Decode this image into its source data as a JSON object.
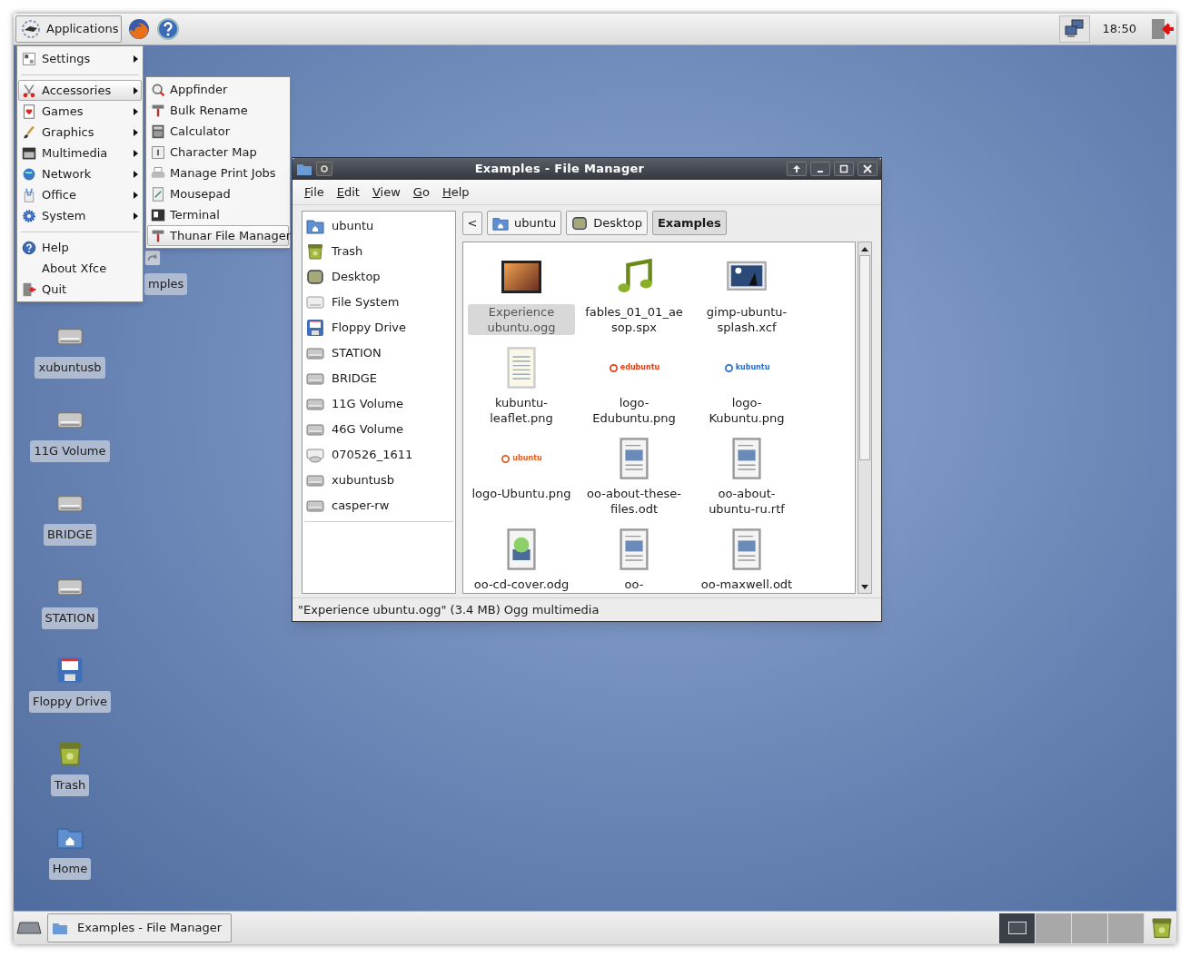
{
  "top_panel": {
    "applications_button": "Applications",
    "clock": "18:50"
  },
  "applications_menu": {
    "items": [
      {
        "kind": "item",
        "label": "Settings",
        "submenu": true,
        "selected": false
      },
      {
        "kind": "separator"
      },
      {
        "kind": "item",
        "label": "Accessories",
        "submenu": true,
        "selected": true
      },
      {
        "kind": "item",
        "label": "Games",
        "submenu": true,
        "selected": false
      },
      {
        "kind": "item",
        "label": "Graphics",
        "submenu": true,
        "selected": false
      },
      {
        "kind": "item",
        "label": "Multimedia",
        "submenu": true,
        "selected": false
      },
      {
        "kind": "item",
        "label": "Network",
        "submenu": true,
        "selected": false
      },
      {
        "kind": "item",
        "label": "Office",
        "submenu": true,
        "selected": false
      },
      {
        "kind": "item",
        "label": "System",
        "submenu": true,
        "selected": false
      },
      {
        "kind": "separator"
      },
      {
        "kind": "item",
        "label": "Help",
        "submenu": false,
        "selected": false
      },
      {
        "kind": "item",
        "label": "About Xfce",
        "submenu": false,
        "selected": false
      },
      {
        "kind": "item",
        "label": "Quit",
        "submenu": false,
        "selected": false
      }
    ]
  },
  "accessories_submenu": {
    "items": [
      {
        "label": "Appfinder",
        "selected": false
      },
      {
        "label": "Bulk Rename",
        "selected": false
      },
      {
        "label": "Calculator",
        "selected": false
      },
      {
        "label": "Character Map",
        "selected": false
      },
      {
        "label": "Manage Print Jobs",
        "selected": false
      },
      {
        "label": "Mousepad",
        "selected": false
      },
      {
        "label": "Terminal",
        "selected": false
      },
      {
        "label": "Thunar File Manager",
        "selected": true
      }
    ]
  },
  "desktop_icons": [
    {
      "label": "mples",
      "kind": "link"
    },
    {
      "label": "xubuntusb",
      "kind": "drive"
    },
    {
      "label": "11G Volume",
      "kind": "drive"
    },
    {
      "label": "BRIDGE",
      "kind": "drive"
    },
    {
      "label": "STATION",
      "kind": "drive"
    },
    {
      "label": "Floppy Drive",
      "kind": "floppy"
    },
    {
      "label": "Trash",
      "kind": "trash"
    },
    {
      "label": "Home",
      "kind": "home"
    }
  ],
  "window": {
    "title": "Examples - File Manager",
    "menu": [
      "File",
      "Edit",
      "View",
      "Go",
      "Help"
    ],
    "sidebar": {
      "items": [
        {
          "label": "ubuntu",
          "kind": "home"
        },
        {
          "label": "Trash",
          "kind": "trash"
        },
        {
          "label": "Desktop",
          "kind": "desktop"
        },
        {
          "label": "File System",
          "kind": "filesystem"
        },
        {
          "label": "Floppy Drive",
          "kind": "floppy"
        },
        {
          "label": "STATION",
          "kind": "drive"
        },
        {
          "label": "BRIDGE",
          "kind": "drive"
        },
        {
          "label": "11G Volume",
          "kind": "drive"
        },
        {
          "label": "46G Volume",
          "kind": "drive"
        },
        {
          "label": "070526_1611",
          "kind": "cdrom"
        },
        {
          "label": "xubuntusb",
          "kind": "drive"
        },
        {
          "label": "casper-rw",
          "kind": "drive"
        }
      ]
    },
    "location": {
      "back_button": "<",
      "path": [
        {
          "label": "ubuntu",
          "kind": "home",
          "selected": false
        },
        {
          "label": "Desktop",
          "kind": "desktop",
          "selected": false
        },
        {
          "label": "Examples",
          "kind": "plain",
          "selected": true
        }
      ]
    },
    "files": [
      {
        "name": "Experience ubuntu.ogg",
        "kind": "video",
        "selected": true
      },
      {
        "name": "fables_01_01_aesop.spx",
        "kind": "audio",
        "selected": false
      },
      {
        "name": "gimp-ubuntu-splash.xcf",
        "kind": "image",
        "selected": false
      },
      {
        "name": "kubuntu-leaflet.png",
        "kind": "leaflet",
        "selected": false
      },
      {
        "name": "logo-Edubuntu.png",
        "kind": "logo",
        "logo_text": "edubuntu",
        "color": "#e0401a",
        "selected": false
      },
      {
        "name": "logo-Kubuntu.png",
        "kind": "logo",
        "logo_text": "kubuntu",
        "color": "#2a6fd0",
        "selected": false
      },
      {
        "name": "logo-Ubuntu.png",
        "kind": "logo",
        "logo_text": "ubuntu",
        "color": "#e8591a",
        "selected": false
      },
      {
        "name": "oo-about-these-files.odt",
        "kind": "document",
        "selected": false
      },
      {
        "name": "oo-about-ubuntu-ru.rtf",
        "kind": "document",
        "selected": false
      },
      {
        "name": "oo-cd-cover.odg",
        "kind": "drawing",
        "selected": false
      },
      {
        "name": "oo-",
        "kind": "document",
        "selected": false
      },
      {
        "name": "oo-maxwell.odt",
        "kind": "document",
        "selected": false
      }
    ],
    "status_bar": "\"Experience ubuntu.ogg\" (3.4 MB) Ogg multimedia"
  },
  "bottom_panel": {
    "tasks": [
      {
        "label": "Examples - File Manager"
      }
    ],
    "workspaces": [
      {
        "selected": true
      },
      {
        "selected": false
      },
      {
        "selected": false
      },
      {
        "selected": false
      }
    ]
  }
}
